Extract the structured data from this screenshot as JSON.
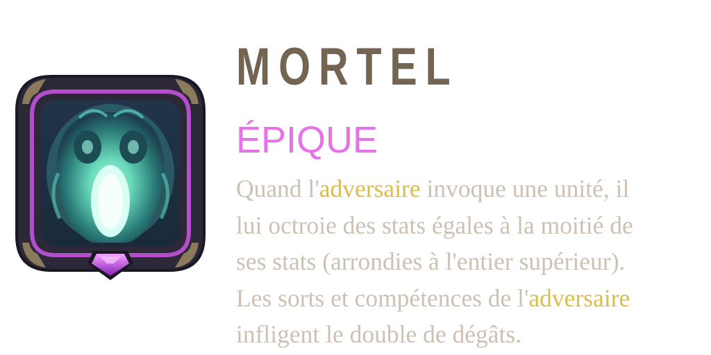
{
  "card": {
    "name": "MORTEL",
    "rarity": "ÉPIQUE",
    "icon": "ghost-skull-icon",
    "gem": "purple-gem-icon",
    "colors": {
      "title": "#746552",
      "rarity": "#e572e6",
      "text": "#cdc1b4",
      "keyword": "#dcbc4e",
      "frame": "#2c2838",
      "frame_border": "#b44fcc",
      "spirit": "#6fe8c4"
    },
    "description": {
      "line1_a": "Quand l'",
      "line1_kw": "adversaire",
      "line1_b": " invoque une unité, il",
      "line2": "lui octroie des stats égales à la moitié de",
      "line3": "ses stats (arrondies à l'entier supérieur).",
      "line4_a": "Les sorts et compétences de l'",
      "line4_kw": "adversaire",
      "line5": "infligent le double de dégâts."
    }
  }
}
